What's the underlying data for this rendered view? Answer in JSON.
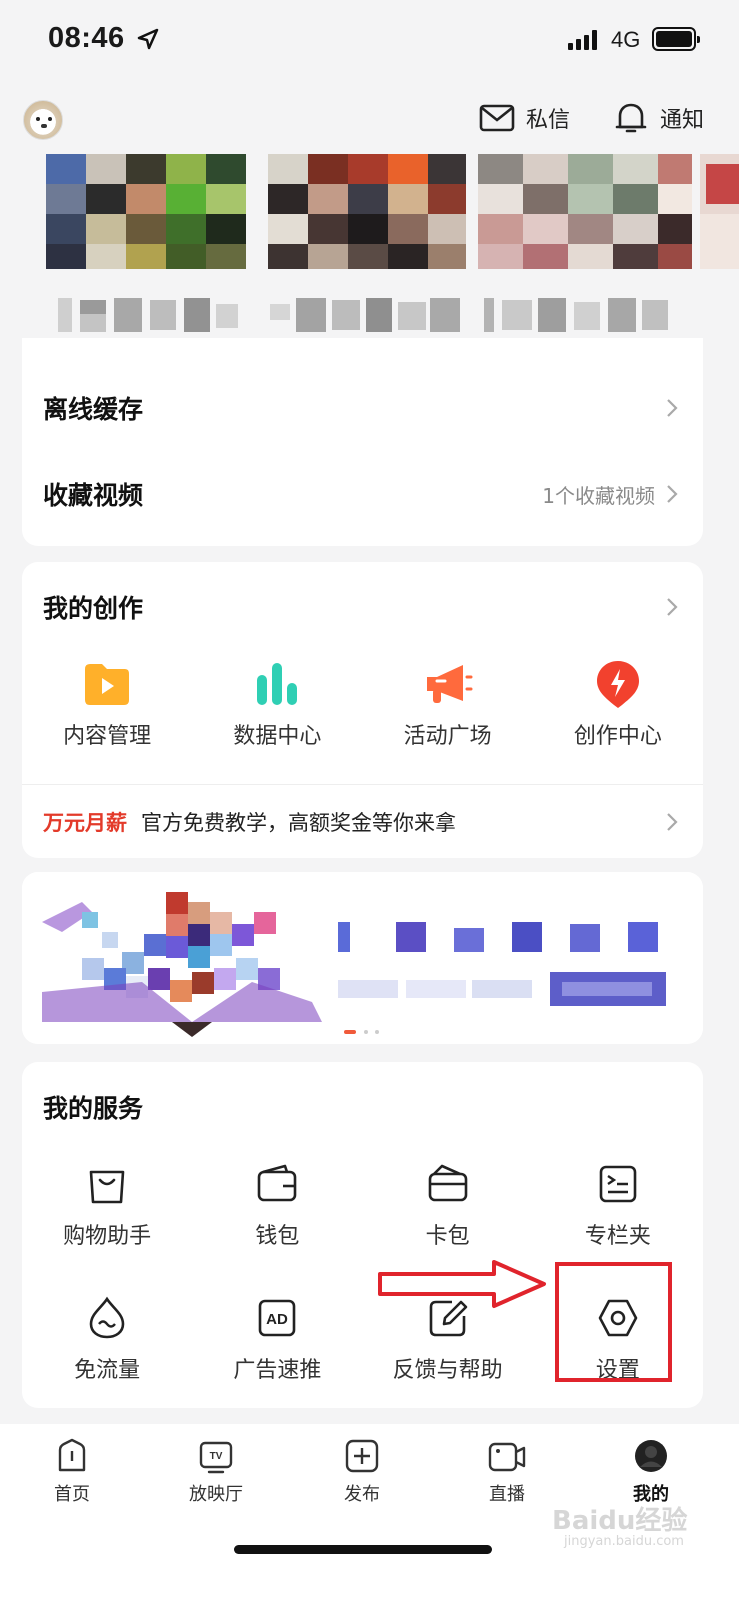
{
  "status_bar": {
    "time": "08:46",
    "network": "4G"
  },
  "header": {
    "messages_label": "私信",
    "notify_label": "通知"
  },
  "list": {
    "offline_cache": "离线缓存",
    "favorites": "收藏视频",
    "favorites_extra": "1个收藏视频"
  },
  "creation": {
    "title": "我的创作",
    "items": [
      {
        "label": "内容管理",
        "icon": "folder-play-icon",
        "color": "#ffb02a"
      },
      {
        "label": "数据中心",
        "icon": "bar-chart-icon",
        "color": "#2fcfb4"
      },
      {
        "label": "活动广场",
        "icon": "megaphone-icon",
        "color": "#ff6a3d"
      },
      {
        "label": "创作中心",
        "icon": "lightning-icon",
        "color": "#f2412e"
      }
    ],
    "promo_highlight": "万元月薪",
    "promo_text": "官方免费教学，高额奖金等你来拿"
  },
  "services": {
    "title": "我的服务",
    "items": [
      {
        "label": "购物助手",
        "icon": "shopping-bag-icon"
      },
      {
        "label": "钱包",
        "icon": "wallet-icon"
      },
      {
        "label": "卡包",
        "icon": "card-holder-icon"
      },
      {
        "label": "专栏夹",
        "icon": "column-folder-icon"
      },
      {
        "label": "免流量",
        "icon": "free-data-icon"
      },
      {
        "label": "广告速推",
        "icon": "ad-icon"
      },
      {
        "label": "反馈与帮助",
        "icon": "feedback-icon"
      },
      {
        "label": "设置",
        "icon": "settings-icon"
      }
    ]
  },
  "tabbar": {
    "items": [
      {
        "label": "首页",
        "icon": "home-icon"
      },
      {
        "label": "放映厅",
        "icon": "tv-icon"
      },
      {
        "label": "发布",
        "icon": "plus-icon"
      },
      {
        "label": "直播",
        "icon": "live-camera-icon"
      },
      {
        "label": "我的",
        "icon": "profile-icon"
      }
    ],
    "active_index": 4
  },
  "watermark": {
    "main": "Baidu经验",
    "sub": "jingyan.baidu.com"
  },
  "colors": {
    "accent_red": "#e33a2a",
    "annotation_red": "#e0242c",
    "page_bg": "#f4f4f5"
  }
}
